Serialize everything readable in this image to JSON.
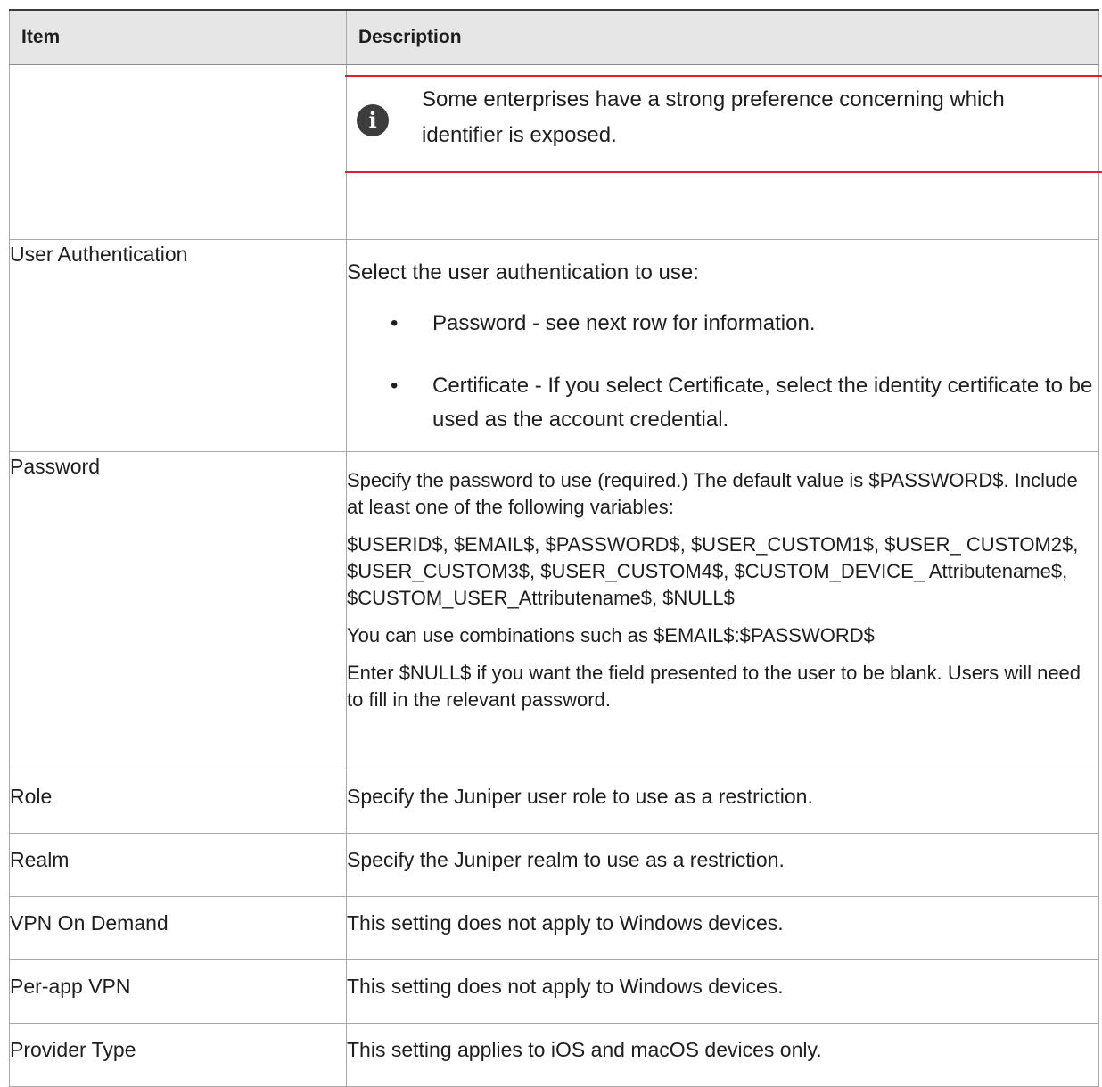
{
  "table": {
    "header": {
      "item": "Item",
      "description": "Description"
    },
    "note": {
      "icon": "info-icon",
      "text": "Some enterprises have a strong preference concerning which identifier is exposed."
    },
    "user_auth": {
      "item": "User Authentication",
      "intro": "Select the user authentication to use:",
      "bullets": [
        "Password - see next row for information.",
        "Certificate - If you select Certificate, select the identity certificate to be used as the account credential."
      ]
    },
    "password": {
      "item": "Password",
      "paragraphs": [
        "Specify the password to use (required.) The default value is $PASSWORD$. Include at least one of the following variables:",
        "$USERID$, $EMAIL$, $PASSWORD$, $USER_CUSTOM1$, $USER_ CUSTOM2$, $USER_CUSTOM3$, $USER_CUSTOM4$, $CUSTOM_DEVICE_ Attributename$, $CUSTOM_USER_Attributename$, $NULL$",
        "You can use combinations such as $EMAIL$:$PASSWORD$",
        "Enter $NULL$ if you want the field presented to the user to be blank. Users will need to fill in the relevant password."
      ]
    },
    "rows": [
      {
        "item": "Role",
        "description": "Specify the Juniper user role to use as a restriction."
      },
      {
        "item": "Realm",
        "description": "Specify the Juniper realm to use as a restriction."
      },
      {
        "item": "VPN On Demand",
        "description": "This setting does not apply to Windows devices."
      },
      {
        "item": "Per-app VPN",
        "description": "This setting does not apply to Windows devices."
      },
      {
        "item": "Provider Type",
        "description": "This setting applies to iOS and macOS devices only."
      }
    ]
  },
  "colors": {
    "note_rule": "#d9222a",
    "header_bg": "#e6e6e6",
    "icon_bg": "#3d3d3d"
  }
}
